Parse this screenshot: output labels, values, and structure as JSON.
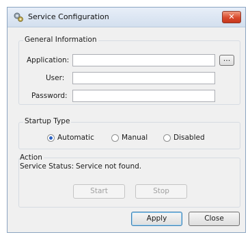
{
  "window": {
    "title": "Service Configuration",
    "close_glyph": "✕",
    "icon": "gear-service-icon"
  },
  "general": {
    "legend": "General Information",
    "application_label": "Application:",
    "application_value": "",
    "browse_label": "...",
    "user_label": "User:",
    "user_value": "",
    "password_label": "Password:",
    "password_value": ""
  },
  "startup": {
    "legend": "Startup Type",
    "options": [
      "Automatic",
      "Manual",
      "Disabled"
    ],
    "selected": "Automatic"
  },
  "action": {
    "legend": "Action",
    "status_label": "Service Status:",
    "status_value": "Service not found.",
    "start_label": "Start",
    "stop_label": "Stop"
  },
  "footer": {
    "apply_label": "Apply",
    "close_label": "Close"
  },
  "colors": {
    "selected_radio": "#2b62c4",
    "close_button": "#d94a2d"
  }
}
